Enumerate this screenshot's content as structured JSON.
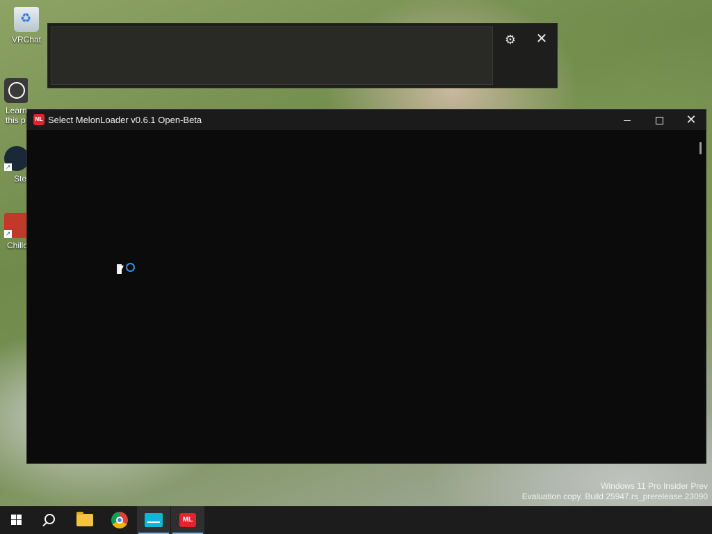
{
  "desktop": {
    "icons": [
      {
        "label": "VRChat"
      },
      {
        "label": "Learn\nthis p"
      },
      {
        "label": "Ste"
      },
      {
        "label": "Chillo"
      }
    ]
  },
  "main_window": {
    "title": "Select MelonLoader v0.6.1 Open-Beta"
  },
  "watermark": {
    "line1": "Windows 11 Pro Insider Prev",
    "line2": "Evaluation copy. Build 25947.rs_prerelease.23090"
  },
  "taskbar": {
    "items": [
      "start-icon",
      "search-icon",
      "file-explorer-icon",
      "chrome-icon",
      "terminal-icon",
      "melonloader-icon"
    ]
  },
  "colors": {
    "accent": "#76b9ed",
    "window_bg": "#0b0b0c",
    "titlebar_bg": "#1b1b1b",
    "taskbar_bg": "#1c1c1c",
    "melonloader_red": "#e0262c",
    "busy_cursor_blue": "#3b8fe0"
  }
}
